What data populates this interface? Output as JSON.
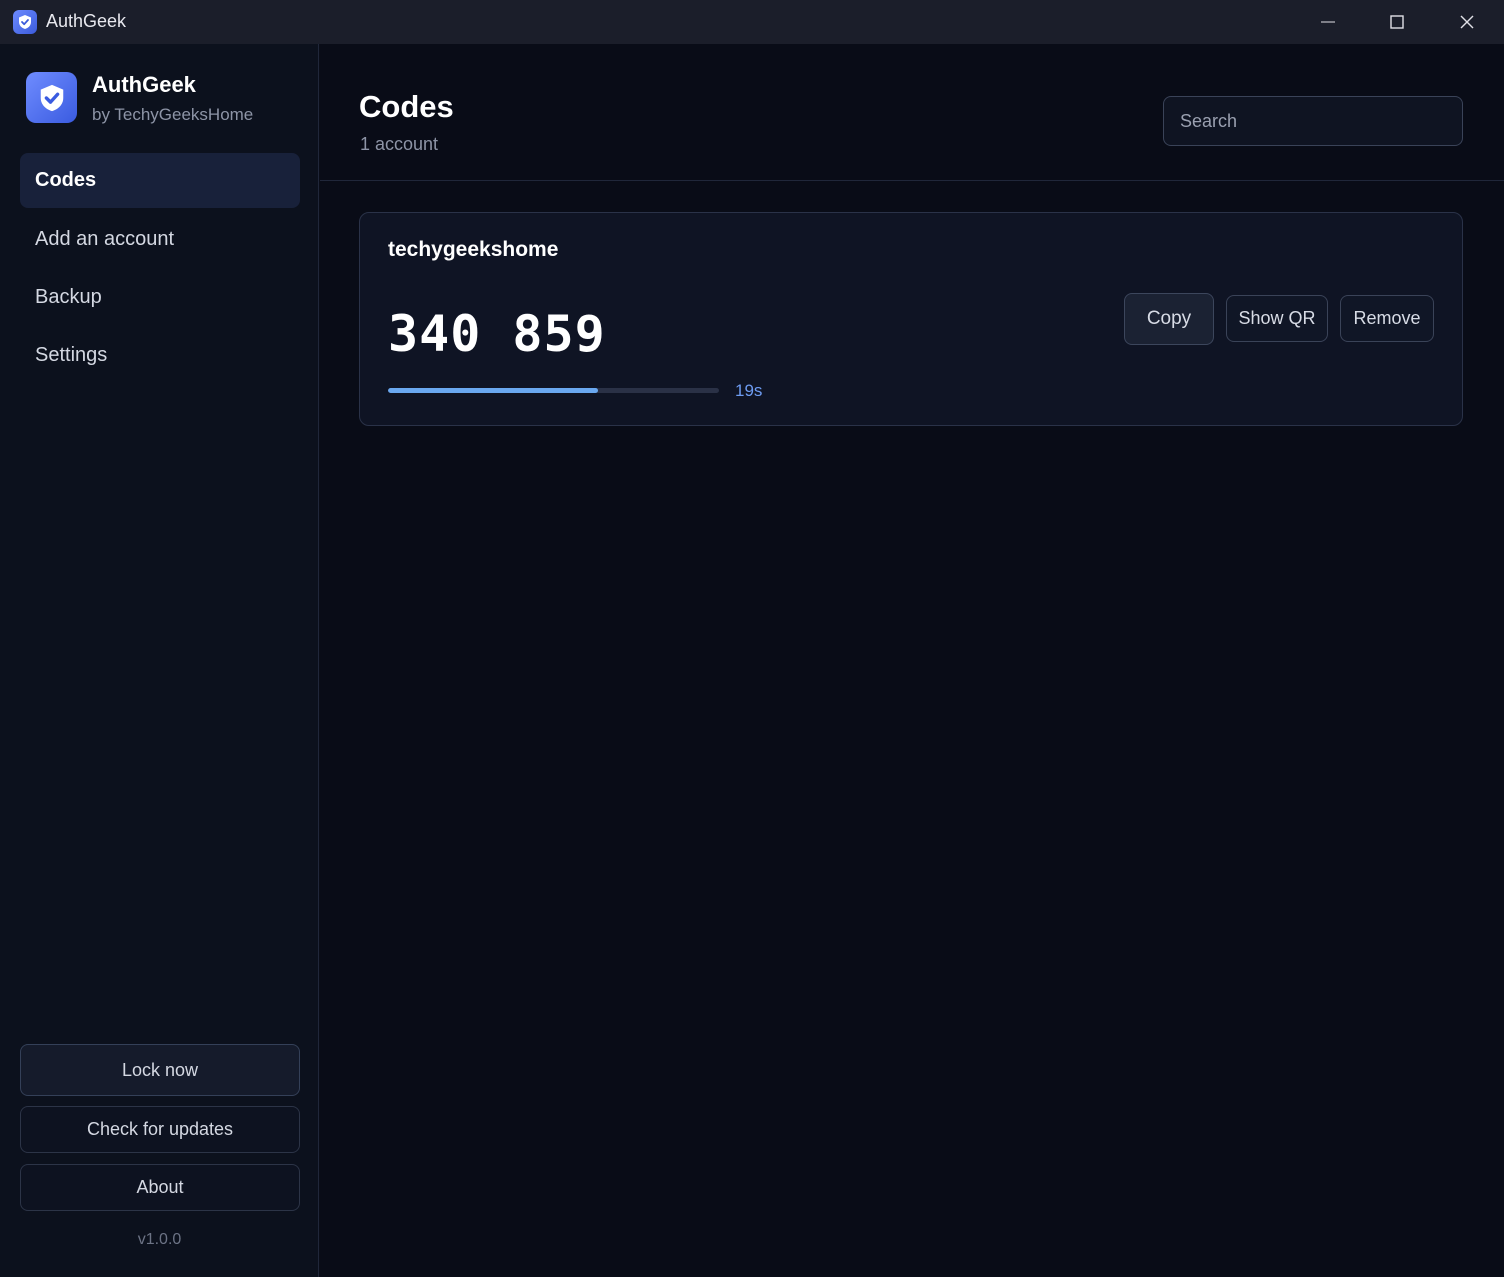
{
  "window": {
    "title": "AuthGeek"
  },
  "brand": {
    "name": "AuthGeek",
    "subtitle": "by TechyGeeksHome"
  },
  "nav": {
    "items": [
      {
        "label": "Codes",
        "active": true
      },
      {
        "label": "Add an account",
        "active": false
      },
      {
        "label": "Backup",
        "active": false
      },
      {
        "label": "Settings",
        "active": false
      }
    ]
  },
  "sidebar_actions": {
    "lock_label": "Lock now",
    "updates_label": "Check for updates",
    "about_label": "About",
    "version": "v1.0.0"
  },
  "header": {
    "title": "Codes",
    "subtitle": "1 account",
    "search_placeholder": "Search"
  },
  "accounts": [
    {
      "name": "techygeekshome",
      "code": "340 859",
      "remaining_label": "19s",
      "progress_fraction": 0.635,
      "actions": {
        "copy": "Copy",
        "show_qr": "Show QR",
        "remove": "Remove"
      }
    }
  ],
  "colors": {
    "accent": "#6aa8f0",
    "accent_text": "#6e9cf2",
    "background": "#090c17",
    "sidebar": "#0c111d"
  }
}
